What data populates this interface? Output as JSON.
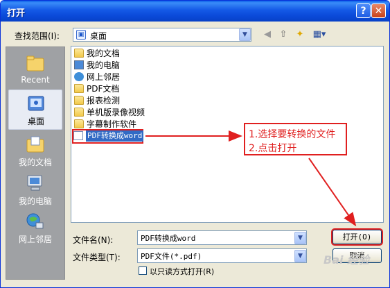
{
  "window": {
    "title": "打开",
    "help_label": "?",
    "close_label": "✕"
  },
  "toolbar": {
    "look_in_label": "查找范围(I):",
    "look_in_value": "桌面",
    "icons": [
      "back-icon",
      "up-folder-icon",
      "new-folder-icon",
      "view-menu-icon"
    ]
  },
  "places": [
    {
      "label": "Recent",
      "icon": "recent-icon",
      "selected": false
    },
    {
      "label": "桌面",
      "icon": "desktop-icon",
      "selected": true
    },
    {
      "label": "我的文档",
      "icon": "my-documents-icon",
      "selected": false
    },
    {
      "label": "我的电脑",
      "icon": "my-computer-icon",
      "selected": false
    },
    {
      "label": "网上邻居",
      "icon": "network-icon",
      "selected": false
    }
  ],
  "files": [
    {
      "name": "我的文档",
      "icon": "my-documents-icon"
    },
    {
      "name": "我的电脑",
      "icon": "my-computer-icon"
    },
    {
      "name": "网上邻居",
      "icon": "network-icon"
    },
    {
      "name": "PDF文档",
      "icon": "folder-icon"
    },
    {
      "name": "报表检测",
      "icon": "folder-icon"
    },
    {
      "name": "单机版录像视频",
      "icon": "folder-icon"
    },
    {
      "name": "字幕制作软件",
      "icon": "folder-icon"
    },
    {
      "name": "PDF转换成word",
      "icon": "pdf-file-icon",
      "selected": true
    }
  ],
  "form": {
    "filename_label": "文件名(N):",
    "filename_value": "PDF转换成word",
    "filetype_label": "文件类型(T):",
    "filetype_value": "PDF文件(*.pdf)",
    "readonly_label": "以只读方式打开(R)",
    "open_button": "打开(O)",
    "cancel_button": "取消"
  },
  "annotation": {
    "line1": "1.选择要转换的文件",
    "line2": "2.点击打开",
    "color": "#e01f1f"
  },
  "watermark": "Bai 经验",
  "colors": {
    "titlebar": "#0a49d8",
    "selection": "#316ac5",
    "annotation": "#e01f1f"
  }
}
